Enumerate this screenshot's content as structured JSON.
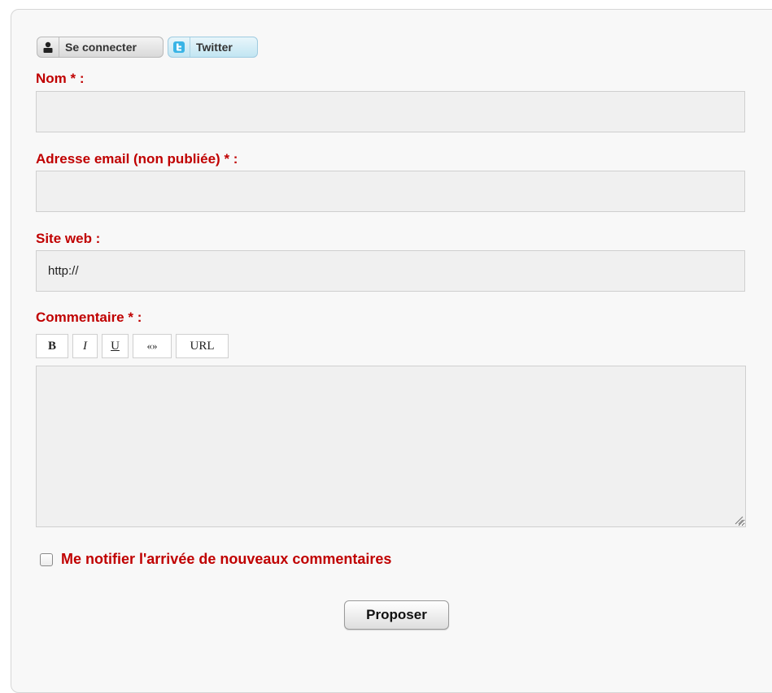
{
  "auth": {
    "connect_label": "Se connecter",
    "connect_icon": "user-icon",
    "twitter_label": "Twitter",
    "twitter_icon": "twitter-icon"
  },
  "form": {
    "name": {
      "label": "Nom * :",
      "value": ""
    },
    "email": {
      "label": "Adresse email (non publiée) * :",
      "value": ""
    },
    "website": {
      "label": "Site web :",
      "value": "http://"
    },
    "comment": {
      "label": "Commentaire * :",
      "value": "",
      "toolbar": [
        {
          "label": "B",
          "name": "bold-button"
        },
        {
          "label": "I",
          "name": "italic-button"
        },
        {
          "label": "U",
          "name": "underline-button"
        },
        {
          "label": "«»",
          "name": "quote-button"
        },
        {
          "label": "URL",
          "name": "url-button"
        }
      ]
    },
    "notify": {
      "label": "Me notifier l'arrivée de nouveaux commentaires",
      "checked": false
    },
    "submit_label": "Proposer"
  },
  "colors": {
    "label_red": "#c00000",
    "input_bg": "#f0f0f0",
    "panel_bg": "#f8f8f8"
  }
}
